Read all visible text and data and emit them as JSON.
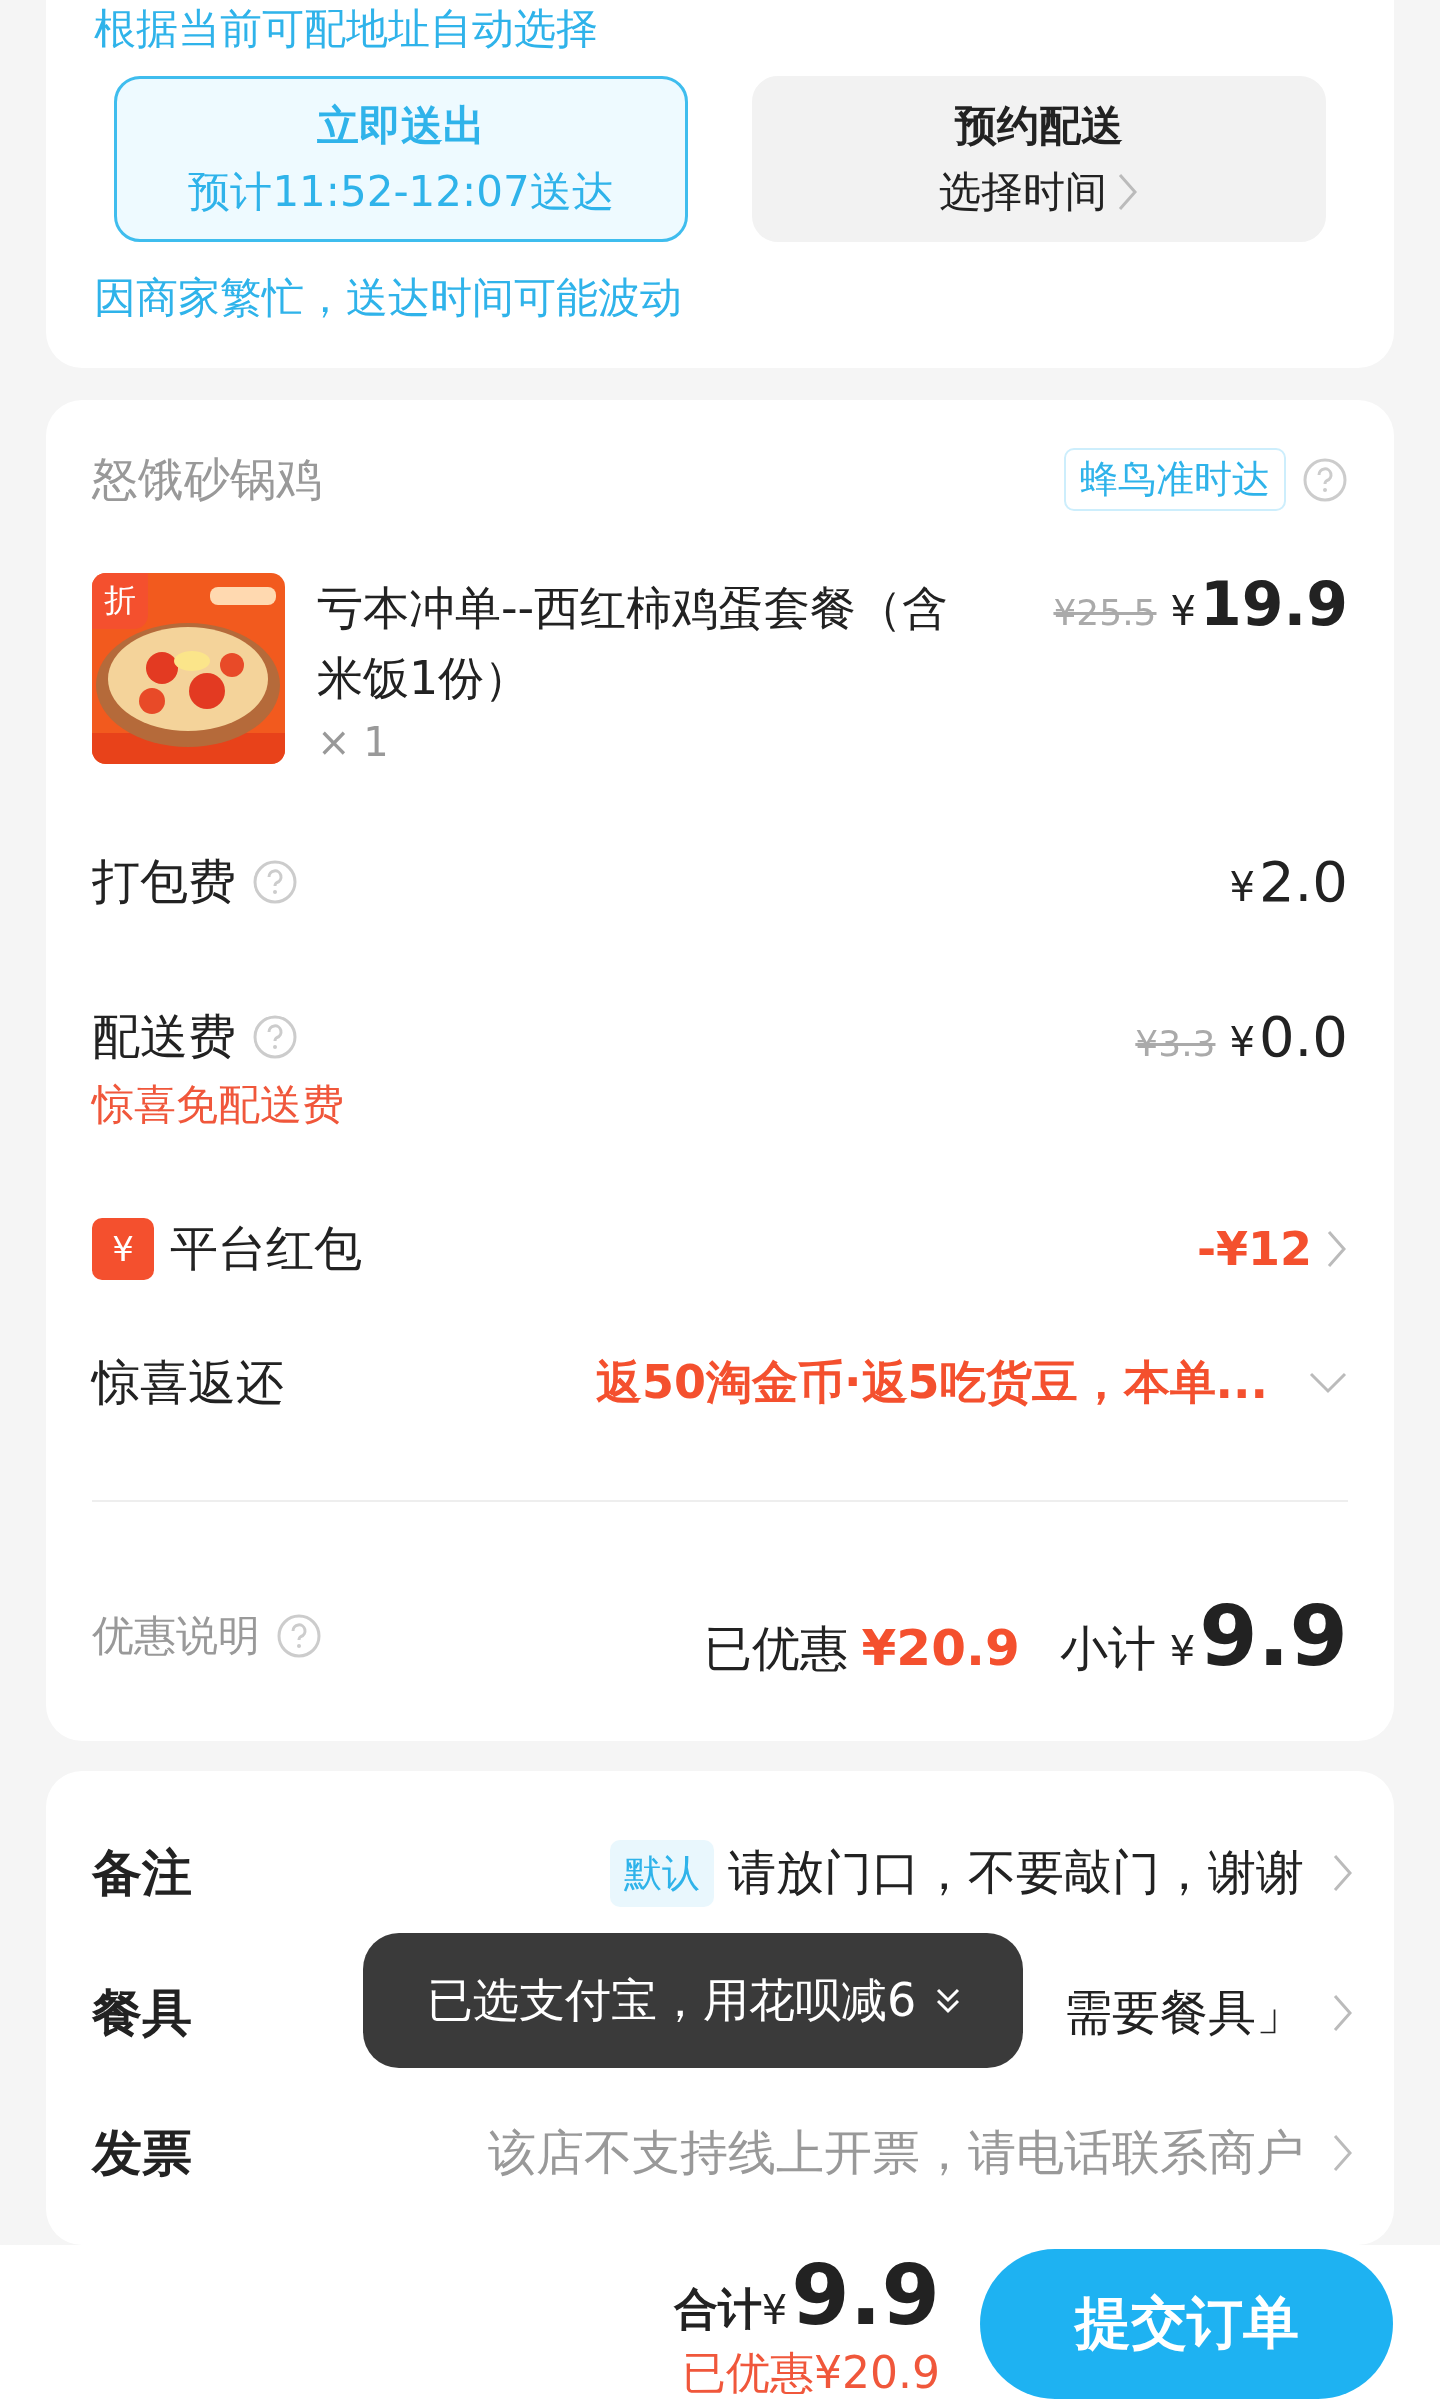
{
  "delivery": {
    "hint": "根据当前可配地址自动选择",
    "options": [
      {
        "title": "立即送出",
        "detail": "预计11:52-12:07送达",
        "selected": true,
        "chevron": false
      },
      {
        "title": "预约配送",
        "detail": "选择时间",
        "selected": false,
        "chevron": true
      }
    ],
    "notice": "因商家繁忙，送达时间可能波动"
  },
  "order": {
    "store": "怒饿砂锅鸡",
    "badge": "蜂鸟准时达",
    "item": {
      "tag": "折",
      "name": "亏本冲单--西红柿鸡蛋套餐（含米饭1份）",
      "qty": "× 1",
      "old_price": "¥25.5",
      "currency": "¥",
      "price": "19.9"
    },
    "fees": [
      {
        "label": "打包费",
        "currency": "¥",
        "value": "2.0"
      },
      {
        "label": "配送费",
        "old": "¥3.3",
        "currency": "¥",
        "value": "0.0",
        "note": "惊喜免配送费"
      }
    ],
    "coupon": {
      "icon": "¥",
      "label": "平台红包",
      "value": "-¥12"
    },
    "rebate": {
      "label": "惊喜返还",
      "value": "返50淘金币·返5吃货豆，本单...",
      "expanded": false
    },
    "summary": {
      "label": "优惠说明",
      "saved_label": "已优惠",
      "saved": "¥20.9",
      "subtotal_label": "小计",
      "currency": "¥",
      "subtotal": "9.9"
    }
  },
  "extras": [
    {
      "label": "备注",
      "tag": "默认",
      "value": "请放门口，不要敲门，谢谢",
      "muted": false
    },
    {
      "label": "餐具",
      "value": "需要餐具」",
      "muted": false
    },
    {
      "label": "发票",
      "value": "该店不支持线上开票，请电话联系商户",
      "muted": true
    }
  ],
  "toast": "已选支付宝，用花呗减6",
  "footer": {
    "total_label": "合计",
    "currency": "¥",
    "total": "9.9",
    "saved": "已优惠¥20.9",
    "submit": "提交订单"
  }
}
